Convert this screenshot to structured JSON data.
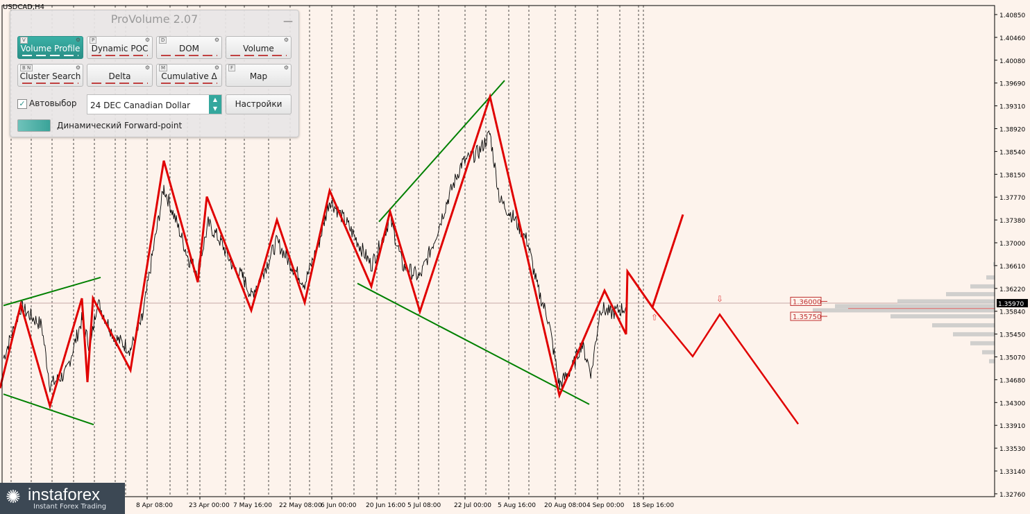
{
  "symbol": "USDCAD,H4",
  "panel": {
    "title": "ProVolume 2.07",
    "minimize": "—",
    "buttons": [
      {
        "label": "Volume Profile",
        "hotkey": "V",
        "active": true
      },
      {
        "label": "Dynamic POC",
        "hotkey": "P",
        "active": false
      },
      {
        "label": "DOM",
        "hotkey": "D",
        "active": false
      },
      {
        "label": "Volume",
        "hotkey": "",
        "active": false
      },
      {
        "label": "Cluster Search",
        "hotkey": "B N",
        "active": false
      },
      {
        "label": "Delta",
        "hotkey": "",
        "active": false
      },
      {
        "label": "Cumulative Δ",
        "hotkey": "M",
        "active": false
      },
      {
        "label": "Map",
        "hotkey": "F",
        "active": false
      }
    ],
    "auto_label": "Автовыбор",
    "auto_checked": "✓",
    "instrument": "24 DEC Canadian Dollar",
    "settings_label": "Настройки",
    "forward_label": "Динамический Forward-point",
    "gear": "⚙"
  },
  "watermark": {
    "brand": "instaforex",
    "tagline": "Instant Forex Trading",
    "mark": "✺"
  },
  "colors": {
    "background": "#fdf3ec",
    "price": "#000000",
    "zigzag": "#e00000",
    "channel": "#008000",
    "profile": "#c8c8c8"
  },
  "chart_data": {
    "type": "line",
    "symbol": "USDCAD,H4",
    "price_ticks": [
      "1.40850",
      "1.40460",
      "1.40080",
      "1.39690",
      "1.39310",
      "1.38920",
      "1.38540",
      "1.38150",
      "1.37770",
      "1.37380",
      "1.37000",
      "1.36610",
      "1.36220",
      "1.35840",
      "1.35450",
      "1.35070",
      "1.34680",
      "1.34300",
      "1.33910",
      "1.33530",
      "1.33140",
      "1.32760"
    ],
    "x_ticks": [
      "8 Apr 08:00",
      "23 Apr 00:00",
      "7 May 16:00",
      "22 May 08:00",
      "6 Jun 00:00",
      "20 Jun 16:00",
      "5 Jul 08:00",
      "22 Jul 00:00",
      "5 Aug 16:00",
      "20 Aug 08:00",
      "4 Sep 00:00",
      "18 Sep 16:00"
    ],
    "current_price": "1.35970",
    "levels": [
      {
        "label": "1.36000",
        "price": 1.36
      },
      {
        "label": "1.35750",
        "price": 1.3575
      }
    ],
    "ylim": [
      1.3276,
      1.4085
    ],
    "zigzag": [
      [
        0,
        1.3455
      ],
      [
        30,
        1.3595
      ],
      [
        72,
        1.3425
      ],
      [
        118,
        1.3605
      ],
      [
        126,
        1.3465
      ],
      [
        134,
        1.3605
      ],
      [
        188,
        1.3485
      ],
      [
        236,
        1.3835
      ],
      [
        285,
        1.3632
      ],
      [
        298,
        1.3775
      ],
      [
        362,
        1.3585
      ],
      [
        399,
        1.3736
      ],
      [
        439,
        1.3598
      ],
      [
        475,
        1.3785
      ],
      [
        535,
        1.3625
      ],
      [
        562,
        1.375
      ],
      [
        605,
        1.3583
      ],
      [
        706,
        1.3942
      ],
      [
        806,
        1.3443
      ],
      [
        871,
        1.3618
      ],
      [
        902,
        1.3545
      ],
      [
        904,
        1.365
      ],
      [
        940,
        1.359
      ],
      [
        984,
        1.3745
      ]
    ],
    "forecast": [
      [
        940,
        1.359
      ],
      [
        998,
        1.3508
      ],
      [
        1037,
        1.3578
      ],
      [
        1150,
        1.3395
      ]
    ],
    "channels": [
      {
        "from": [
          5,
          1.3593
        ],
        "to": [
          145,
          1.364
        ]
      },
      {
        "from": [
          5,
          1.3445
        ],
        "to": [
          135,
          1.3394
        ]
      },
      {
        "from": [
          546,
          1.3733
        ],
        "to": [
          727,
          1.3969
        ]
      },
      {
        "from": [
          515,
          1.363
        ],
        "to": [
          849,
          1.3428
        ]
      }
    ],
    "price_path_anchors": [
      [
        5,
        1.3505
      ],
      [
        30,
        1.359
      ],
      [
        60,
        1.356
      ],
      [
        72,
        1.346
      ],
      [
        95,
        1.348
      ],
      [
        118,
        1.357
      ],
      [
        130,
        1.352
      ],
      [
        140,
        1.36
      ],
      [
        165,
        1.354
      ],
      [
        188,
        1.352
      ],
      [
        205,
        1.357
      ],
      [
        220,
        1.368
      ],
      [
        236,
        1.379
      ],
      [
        255,
        1.373
      ],
      [
        272,
        1.367
      ],
      [
        285,
        1.365
      ],
      [
        300,
        1.373
      ],
      [
        318,
        1.37
      ],
      [
        335,
        1.366
      ],
      [
        350,
        1.364
      ],
      [
        362,
        1.361
      ],
      [
        380,
        1.365
      ],
      [
        399,
        1.37
      ],
      [
        420,
        1.366
      ],
      [
        439,
        1.363
      ],
      [
        460,
        1.37
      ],
      [
        475,
        1.377
      ],
      [
        500,
        1.373
      ],
      [
        520,
        1.369
      ],
      [
        535,
        1.366
      ],
      [
        550,
        1.37
      ],
      [
        562,
        1.374
      ],
      [
        580,
        1.366
      ],
      [
        605,
        1.364
      ],
      [
        625,
        1.37
      ],
      [
        645,
        1.377
      ],
      [
        665,
        1.383
      ],
      [
        690,
        1.385
      ],
      [
        706,
        1.388
      ],
      [
        720,
        1.377
      ],
      [
        740,
        1.374
      ],
      [
        760,
        1.37
      ],
      [
        775,
        1.362
      ],
      [
        790,
        1.357
      ],
      [
        806,
        1.346
      ],
      [
        825,
        1.349
      ],
      [
        838,
        1.353
      ],
      [
        852,
        1.348
      ],
      [
        865,
        1.359
      ],
      [
        880,
        1.358
      ],
      [
        902,
        1.359
      ]
    ],
    "volume_profile": [
      [
        1.3662,
        2
      ],
      [
        1.364,
        12
      ],
      [
        1.3625,
        35
      ],
      [
        1.3612,
        70
      ],
      [
        1.36,
        140
      ],
      [
        1.3592,
        230
      ],
      [
        1.3585,
        262
      ],
      [
        1.3575,
        150
      ],
      [
        1.356,
        90
      ],
      [
        1.3545,
        60
      ],
      [
        1.353,
        35
      ],
      [
        1.3515,
        18
      ],
      [
        1.35,
        8
      ]
    ]
  }
}
